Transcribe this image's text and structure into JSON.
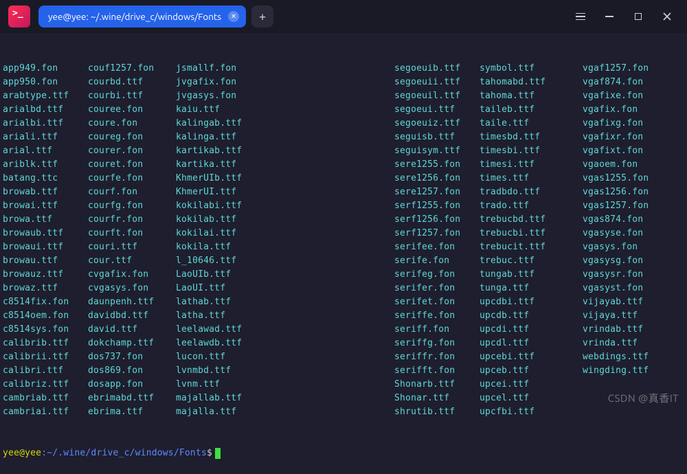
{
  "titlebar": {
    "app_icon_glyph": ">_",
    "tab_title": "yee@yee: ~/.wine/drive_c/windows/Fonts",
    "tab_close_glyph": "✕",
    "new_tab_glyph": "+"
  },
  "prompt": {
    "user": "yee@yee",
    "sep": ":",
    "path": "~/.wine/drive_c/windows/Fonts",
    "symbol": "$"
  },
  "columns": [
    [
      "app949.fon",
      "app950.fon",
      "arabtype.ttf",
      "arialbd.ttf",
      "arialbi.ttf",
      "ariali.ttf",
      "arial.ttf",
      "ariblk.ttf",
      "batang.ttc",
      "browab.ttf",
      "browai.ttf",
      "browa.ttf",
      "browaub.ttf",
      "browaui.ttf",
      "browau.ttf",
      "browauz.ttf",
      "browaz.ttf",
      "c8514fix.fon",
      "c8514oem.fon",
      "c8514sys.fon",
      "calibrib.ttf",
      "calibrii.ttf",
      "calibri.ttf",
      "calibriz.ttf",
      "cambriab.ttf",
      "cambriai.ttf"
    ],
    [
      "couf1257.fon",
      "courbd.ttf",
      "courbi.ttf",
      "couree.fon",
      "coure.fon",
      "coureg.fon",
      "courer.fon",
      "couret.fon",
      "courfe.fon",
      "courf.fon",
      "courfg.fon",
      "courfr.fon",
      "courft.fon",
      "couri.ttf",
      "cour.ttf",
      "cvgafix.fon",
      "cvgasys.fon",
      "daunpenh.ttf",
      "davidbd.ttf",
      "david.ttf",
      "dokchamp.ttf",
      "dos737.fon",
      "dos869.fon",
      "dosapp.fon",
      "ebrimabd.ttf",
      "ebrima.ttf"
    ],
    [
      "jsmallf.fon",
      "jvgafix.fon",
      "jvgasys.fon",
      "kaiu.ttf",
      "kalingab.ttf",
      "kalinga.ttf",
      "kartikab.ttf",
      "kartika.ttf",
      "KhmerUIb.ttf",
      "KhmerUI.ttf",
      "kokilabi.ttf",
      "kokilab.ttf",
      "kokilai.ttf",
      "kokila.ttf",
      "l_10646.ttf",
      "LaoUIb.ttf",
      "LaoUI.ttf",
      "lathab.ttf",
      "latha.ttf",
      "leelawad.ttf",
      "leelawdb.ttf",
      "lucon.ttf",
      "lvnmbd.ttf",
      "lvnm.ttf",
      "majallab.ttf",
      "majalla.ttf"
    ],
    [
      "",
      "",
      "",
      "",
      "",
      "",
      "",
      "",
      "",
      "",
      "",
      "",
      "",
      "",
      "",
      "",
      "",
      "",
      "",
      "",
      "",
      "",
      "",
      "",
      "",
      ""
    ],
    [
      "segoeuib.ttf",
      "segoeuii.ttf",
      "segoeuil.ttf",
      "segoeui.ttf",
      "segoeuiz.ttf",
      "seguisb.ttf",
      "seguisym.ttf",
      "sere1255.fon",
      "sere1256.fon",
      "sere1257.fon",
      "serf1255.fon",
      "serf1256.fon",
      "serf1257.fon",
      "serifee.fon",
      "serife.fon",
      "serifeg.fon",
      "serifer.fon",
      "serifet.fon",
      "seriffe.fon",
      "seriff.fon",
      "seriffg.fon",
      "seriffr.fon",
      "serifft.fon",
      "Shonarb.ttf",
      "Shonar.ttf",
      "shrutib.ttf"
    ],
    [
      "symbol.ttf",
      "tahomabd.ttf",
      "tahoma.ttf",
      "taileb.ttf",
      "taile.ttf",
      "timesbd.ttf",
      "timesbi.ttf",
      "timesi.ttf",
      "times.ttf",
      "tradbdo.ttf",
      "trado.ttf",
      "trebucbd.ttf",
      "trebucbi.ttf",
      "trebucit.ttf",
      "trebuc.ttf",
      "tungab.ttf",
      "tunga.ttf",
      "upcdbi.ttf",
      "upcdb.ttf",
      "upcdi.ttf",
      "upcdl.ttf",
      "upcebi.ttf",
      "upceb.ttf",
      "upcei.ttf",
      "upcel.ttf",
      "upcfbi.ttf"
    ],
    [
      "vgaf1257.fon",
      "vgaf874.fon",
      "vgafixe.fon",
      "vgafix.fon",
      "vgafixg.fon",
      "vgafixr.fon",
      "vgafixt.fon",
      "vgaoem.fon",
      "vgas1255.fon",
      "vgas1256.fon",
      "vgas1257.fon",
      "vgas874.fon",
      "vgasyse.fon",
      "vgasys.fon",
      "vgasysg.fon",
      "vgasysr.fon",
      "vgasyst.fon",
      "vijayab.ttf",
      "vijaya.ttf",
      "vrindab.ttf",
      "vrinda.ttf",
      "webdings.ttf",
      "wingding.ttf",
      "",
      "",
      ""
    ]
  ],
  "watermark": "CSDN @真香IT"
}
